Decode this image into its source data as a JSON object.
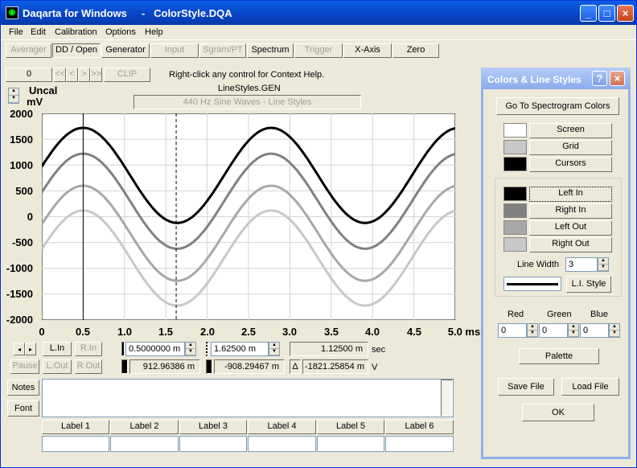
{
  "window": {
    "title": "Daqarta for Windows     -   ColorStyle.DQA",
    "icon": "daqarta-icon"
  },
  "menu": [
    "File",
    "Edit",
    "Calibration",
    "Options",
    "Help"
  ],
  "toolbar": {
    "buttons": [
      "Averager",
      "DD / Open",
      "Generator",
      "Input",
      "Sgram/PT",
      "Spectrum",
      "Trigger",
      "X-Axis",
      "Zero"
    ]
  },
  "nav": {
    "counter": "0",
    "arrows": [
      "<<",
      "<",
      ">",
      ">>"
    ],
    "clip": "CLIP",
    "help": "Right-click any control for Context Help.",
    "gen_file": "LineStyles.GEN",
    "description": "440 Hz Sine Waves - Line Styles"
  },
  "yaxis": {
    "cal": "Uncal",
    "unit": "mV",
    "ticks": [
      "2000",
      "1500",
      "1000",
      "500",
      "0",
      "-500",
      "-1000",
      "-1500",
      "-2000"
    ]
  },
  "xaxis": {
    "ticks": [
      "0",
      "0.5",
      "1.0",
      "1.5",
      "2.0",
      "2.5",
      "3.0",
      "3.5",
      "4.0",
      "4.5",
      "5.0 ms"
    ]
  },
  "chart_data": {
    "type": "line",
    "xlabel": "ms",
    "ylabel": "mV",
    "xlim": [
      0,
      5
    ],
    "ylim": [
      -2000,
      2000
    ],
    "grid": true,
    "frequency_hz": 440,
    "series": [
      {
        "amplitude": 920,
        "offset": 800,
        "color": "#000000"
      },
      {
        "amplitude": 920,
        "offset": 300,
        "color": "#808080"
      },
      {
        "amplitude": 920,
        "offset": -320,
        "color": "#a8a8a8"
      },
      {
        "amplitude": 920,
        "offset": -800,
        "color": "#c8c8c8"
      }
    ],
    "cursors": [
      {
        "x": 0.5,
        "style": "solid"
      },
      {
        "x": 1.625,
        "style": "dashed"
      }
    ]
  },
  "readouts": {
    "cursor1": "0.5000000 m",
    "cursor2": "1.62500 m",
    "delta_t": "1.12500 m",
    "t_unit": "sec",
    "v1": "912.96386 m",
    "v2": "-908.29467 m",
    "delta_sym": "Δ",
    "dv": "-1821.25854 m",
    "v_unit": "V"
  },
  "ctrl": {
    "lin": "L.In",
    "rin": "R.In",
    "pause": "Pause",
    "lout": "L.Out",
    "rout": "R.Out",
    "notes": "Notes",
    "font": "Font"
  },
  "labels": [
    "Label 1",
    "Label 2",
    "Label 3",
    "Label 4",
    "Label 5",
    "Label 6"
  ],
  "dialog": {
    "title": "Colors & Line Styles",
    "spectro": "Go To Spectrogram Colors",
    "items": [
      {
        "label": "Screen",
        "color": "#ffffff"
      },
      {
        "label": "Grid",
        "color": "#c8c8c8"
      },
      {
        "label": "Cursors",
        "color": "#000000"
      }
    ],
    "channels": [
      {
        "label": "Left In",
        "color": "#000000"
      },
      {
        "label": "Right In",
        "color": "#808080"
      },
      {
        "label": "Left Out",
        "color": "#a8a8a8"
      },
      {
        "label": "Right Out",
        "color": "#c8c8c8"
      }
    ],
    "line_width_label": "Line Width",
    "line_width": "3",
    "li_style": "L.I. Style",
    "red": "Red",
    "green": "Green",
    "blue": "Blue",
    "r": "0",
    "g": "0",
    "b": "0",
    "palette": "Palette",
    "save": "Save File",
    "load": "Load File",
    "ok": "OK"
  }
}
